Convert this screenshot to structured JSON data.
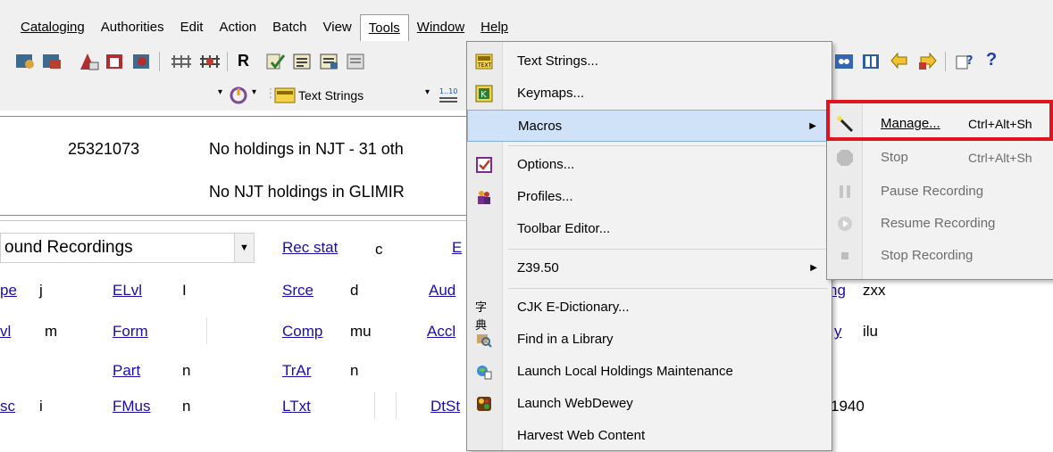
{
  "menubar": {
    "items": [
      "Cataloging",
      "Authorities",
      "Edit",
      "Action",
      "Batch",
      "View",
      "Tools",
      "Window",
      "Help"
    ],
    "active": "Tools"
  },
  "toolbar": {
    "text_strings_label": "Text Strings"
  },
  "record": {
    "oclc_number": "25321073",
    "holdings_line1": "No holdings in NJT - 31 oth",
    "holdings_line2": "No NJT holdings in GLIMIR"
  },
  "fixed_field": {
    "format_value": "ound Recordings",
    "rows": [
      [
        {
          "label": "Rec stat",
          "value": "c"
        },
        {
          "label": "E",
          "value": ""
        }
      ],
      [
        {
          "label": "pe",
          "value": "j"
        },
        {
          "label": "ELvl",
          "value": "I"
        },
        {
          "label": "Srce",
          "value": "d"
        },
        {
          "label": "Aud",
          "value": ""
        },
        {
          "label": "ng",
          "value": "zxx"
        }
      ],
      [
        {
          "label": "vl",
          "value": "m"
        },
        {
          "label": "Form",
          "value": ""
        },
        {
          "label": "Comp",
          "value": "mu"
        },
        {
          "label": "Accl",
          "value": ""
        },
        {
          "label": "y",
          "value": "ilu"
        }
      ],
      [
        {
          "label": "Part",
          "value": "n"
        },
        {
          "label": "TrAr",
          "value": "n"
        }
      ],
      [
        {
          "label": "sc",
          "value": "i"
        },
        {
          "label": "FMus",
          "value": "n"
        },
        {
          "label": "LTxt",
          "value": ""
        },
        {
          "label": "DtSt",
          "value": ""
        },
        {
          "label": "",
          "value": "1940"
        }
      ]
    ]
  },
  "tools_menu": {
    "items": [
      {
        "label": "Text Strings...",
        "icon": "text-strings-icon"
      },
      {
        "label": "Keymaps...",
        "icon": "keymaps-icon"
      },
      {
        "label": "Macros",
        "icon": "",
        "submenu": true,
        "highlighted": true
      },
      {
        "label": "Options...",
        "icon": "options-icon"
      },
      {
        "label": "Profiles...",
        "icon": "profiles-icon"
      },
      {
        "label": "Toolbar Editor...",
        "icon": ""
      },
      {
        "label": "Z39.50",
        "icon": "",
        "submenu": true
      },
      {
        "label": "CJK E-Dictionary...",
        "icon": "cjk-dictionary-icon"
      },
      {
        "label": "Find in a Library",
        "icon": "find-library-icon"
      },
      {
        "label": "Launch Local Holdings Maintenance",
        "icon": "holdings-maintenance-icon"
      },
      {
        "label": "Launch WebDewey",
        "icon": "webdewey-icon"
      },
      {
        "label": "Harvest Web Content",
        "icon": ""
      }
    ]
  },
  "macros_submenu": {
    "items": [
      {
        "label": "Manage...",
        "shortcut": "Ctrl+Alt+Sh",
        "enabled": true,
        "icon": "magic-wand-icon"
      },
      {
        "label": "Stop",
        "shortcut": "Ctrl+Alt+Sh",
        "enabled": false,
        "icon": "stop-icon"
      },
      {
        "label": "Pause Recording",
        "shortcut": "",
        "enabled": false,
        "icon": "pause-icon"
      },
      {
        "label": "Resume Recording",
        "shortcut": "",
        "enabled": false,
        "icon": "resume-icon"
      },
      {
        "label": "Stop Recording",
        "shortcut": "",
        "enabled": false,
        "icon": "stop-recording-icon"
      }
    ]
  },
  "colors": {
    "link": "#1a0dab",
    "highlight": "#cfe2f7",
    "annotation_box": "#e0141e"
  }
}
